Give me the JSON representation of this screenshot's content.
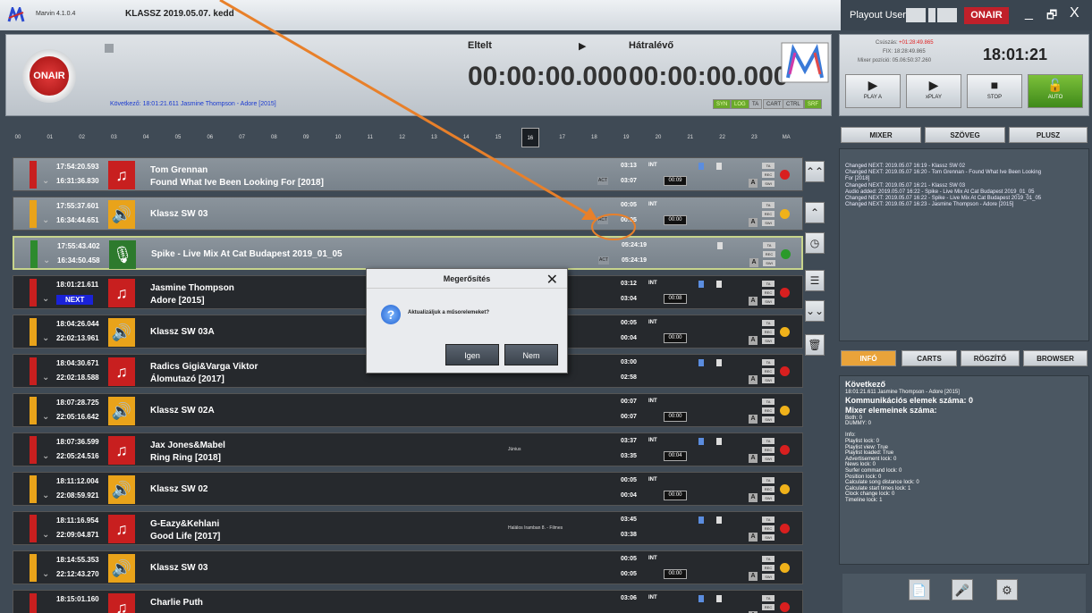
{
  "app": {
    "version": "Marvin 4.1.0.4",
    "title": "KLASSZ 2019.05.07. kedd",
    "user": "Playout User",
    "onair": "ONAIR"
  },
  "window": {
    "minimize": "_",
    "restore": "🗗",
    "close": "X"
  },
  "header": {
    "onair_label": "ONAIR",
    "next_line": "Következő: 18:01:21.611 Jasmine Thompson - Adore [2015]",
    "elapsed_label": "Eltelt",
    "elapsed": "00:00:00.000",
    "remaining_label": "Hátralévő",
    "remaining": "00:00:00.000",
    "status": [
      "SYN",
      "LOG",
      "TA",
      "CART",
      "CTRL",
      "SRF"
    ]
  },
  "right_panel": {
    "csusz_label": "Csúszás:",
    "csusz": "+01:28:49.865",
    "fix": "FIX: 18:28:49.865",
    "mixer_pos": "Mixer pozíció: 05.06:50:37.260",
    "clock": "18:01:21",
    "buttons": [
      "PLAY A",
      "xPLAY",
      "STOP",
      "AUTO"
    ]
  },
  "hours": [
    "00",
    "01",
    "02",
    "03",
    "04",
    "05",
    "06",
    "07",
    "08",
    "09",
    "10",
    "11",
    "12",
    "13",
    "14",
    "15",
    "16",
    "17",
    "18",
    "19",
    "20",
    "21",
    "22",
    "23",
    "MA"
  ],
  "tabs_top": [
    "MIXER",
    "SZÖVEG",
    "PLUSZ"
  ],
  "log": [
    "Changed NEXT: 2019.05.07 16:19 - Klassz SW 02",
    "Changed NEXT: 2019.05.07 16:20 - Tom Grennan - Found What Ive Been Looking",
    "For [2018]",
    "Changed NEXT: 2019.05.07 16:21 - Klassz SW 03",
    "Audio added: 2019.05.07 16:22 - Spike - Live Mix At Cat Budapest 2019_01_05",
    "Changed NEXT: 2019.05.07 16:22 - Spike - Live Mix At Cat Budapest 2019_01_05",
    "Changed NEXT: 2019.05.07 16:23 - Jasmine Thompson - Adore [2015]"
  ],
  "tabs_bottom": [
    "INFÓ",
    "CARTS",
    "RÖGZÍTŐ",
    "BROWSER"
  ],
  "info": {
    "title": "Következő",
    "next": "18:01:21.611  Jasmine Thompson - Adore [2015]",
    "komm": "Kommunikációs elemek száma:  0",
    "mixer": "Mixer elemeinek száma:",
    "lines": [
      "Both: 0",
      "DUMMY: 0",
      "",
      "Info:",
      "Playlist lock: 0",
      "Playlist view: True",
      "Playlist loaded: True",
      "Advertisement lock: 0",
      "News lock: 0",
      "Surfer command lock: 0",
      "Position lock: 0",
      "Calculate song distance lock: 0",
      "Calculate start times lock: 1",
      "Clock change lock: 0",
      "Timeline lock: 1"
    ]
  },
  "rows": [
    {
      "t1": "17:54:20.593",
      "t2": "16:31:36.830",
      "type": "music",
      "artist": "Tom Grennan",
      "title": "Found What Ive Been Looking For [2018]",
      "d1": "03:13",
      "d2": "03:07",
      "box": "00:09",
      "int": "INT",
      "act": "ACT",
      "bar": "#c81f1f",
      "led": "#d81f1f",
      "style": "grey"
    },
    {
      "t1": "17:55:37.601",
      "t2": "16:34:44.651",
      "type": "audio",
      "single": "Klassz SW 03",
      "d1": "00:05",
      "d2": "00:05",
      "box": "00:00",
      "int": "INT",
      "act": "ACT",
      "bar": "#e9a31a",
      "led": "#f0b21a",
      "style": "grey"
    },
    {
      "t1": "17:55:43.402",
      "t2": "16:34:50.458",
      "type": "mic",
      "single": "Spike - Live Mix At Cat Budapest 2019_01_05",
      "d1": "05:24:19",
      "d2": "05:24:19",
      "act": "ACT",
      "bar": "#2d8a2d",
      "led": "#2a9a2a",
      "style": "cur"
    },
    {
      "t1": "18:01:21.611",
      "t2": "NEXT",
      "type": "music",
      "artist": "Jasmine Thompson",
      "title": "Adore [2015]",
      "d1": "03:12",
      "d2": "03:04",
      "box": "00:08",
      "int": "INT",
      "bar": "#c81f1f",
      "led": "#d81f1f",
      "style": "dark"
    },
    {
      "t1": "18:04:26.044",
      "t2": "22:02:13.961",
      "type": "audio",
      "single": "Klassz SW 03A",
      "d1": "00:05",
      "d2": "00:04",
      "box": "00:00",
      "int": "INT",
      "bar": "#e9a31a",
      "led": "#f0b21a",
      "style": "dark"
    },
    {
      "t1": "18:04:30.671",
      "t2": "22:02:18.588",
      "type": "music",
      "artist": "Radics Gigi&Varga Viktor",
      "title": "Álomutazó [2017]",
      "d1": "03:00",
      "d2": "02:58",
      "bar": "#c81f1f",
      "led": "#d81f1f",
      "style": "dark"
    },
    {
      "t1": "18:07:28.725",
      "t2": "22:05:16.642",
      "type": "audio",
      "single": "Klassz SW 02A",
      "d1": "00:07",
      "d2": "00:07",
      "box": "00:00",
      "int": "INT",
      "bar": "#e9a31a",
      "led": "#f0b21a",
      "style": "dark"
    },
    {
      "t1": "18:07:36.599",
      "t2": "22:05:24.516",
      "type": "music",
      "artist": "Jax Jones&Mabel",
      "title": "Ring Ring [2018]",
      "mid": "Június",
      "d1": "03:37",
      "d2": "03:35",
      "box": "00:04",
      "int": "INT",
      "bar": "#c81f1f",
      "led": "#d81f1f",
      "style": "dark"
    },
    {
      "t1": "18:11:12.004",
      "t2": "22:08:59.921",
      "type": "audio",
      "single": "Klassz SW 02",
      "d1": "00:05",
      "d2": "00:04",
      "box": "00:00",
      "int": "INT",
      "bar": "#e9a31a",
      "led": "#f0b21a",
      "style": "dark"
    },
    {
      "t1": "18:11:16.954",
      "t2": "22:09:04.871",
      "type": "music",
      "artist": "G-Eazy&Kehlani",
      "title": "Good Life [2017]",
      "mid": "Halálos Iramban 8. - Filmes",
      "d1": "03:45",
      "d2": "03:38",
      "bar": "#c81f1f",
      "led": "#d81f1f",
      "style": "dark"
    },
    {
      "t1": "18:14:55.353",
      "t2": "22:12:43.270",
      "type": "audio",
      "single": "Klassz SW 03",
      "d1": "00:05",
      "d2": "00:05",
      "box": "00:00",
      "int": "INT",
      "bar": "#e9a31a",
      "led": "#f0b21a",
      "style": "dark"
    },
    {
      "t1": "18:15:01.160",
      "t2": "",
      "type": "music",
      "artist": "Charlie Puth",
      "title": "",
      "d1": "03:06",
      "d2": "",
      "int": "INT",
      "bar": "#c81f1f",
      "led": "#d81f1f",
      "style": "dark"
    }
  ],
  "mini": {
    "ta": "TA",
    "rec": "REC",
    "swi": "SWI",
    "a": "A"
  },
  "dialog": {
    "title": "Megerősítés",
    "text": "Aktualizáljuk a műsorelemeket?",
    "yes": "Igen",
    "no": "Nem",
    "close": "✕"
  },
  "sidebuttons": [
    "⌃⌃",
    "⌃",
    "◷",
    "☰",
    "⌄⌄",
    "🗑"
  ],
  "tools": [
    "📄",
    "🎤",
    "⚙"
  ]
}
